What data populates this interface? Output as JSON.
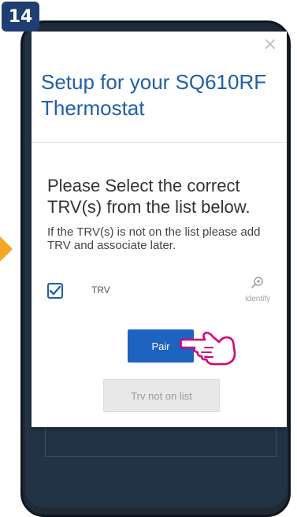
{
  "step": {
    "number": "14"
  },
  "modal": {
    "close_symbol": "×",
    "title": "Setup for your SQ610RF Thermostat",
    "instruction": "Please Select the correct TRV(s) from the list below.",
    "subtext": "If the TRV(s) is not on the list please add TRV and associate later.",
    "trv_list": [
      {
        "label": "TRV",
        "checked": true,
        "identify_label": "Identify",
        "identify_icon": "magnifier-icon"
      }
    ],
    "pair_label": "Pair",
    "not_on_list_label": "Trv not on list"
  },
  "colors": {
    "accent": "#1e63c0",
    "title": "#1f5fa8",
    "badge": "#1f3f73",
    "guide_arrow": "#f5a623",
    "pointer_hand": "#d4007a"
  },
  "icons": {
    "pointer": "pointing-hand-icon"
  }
}
